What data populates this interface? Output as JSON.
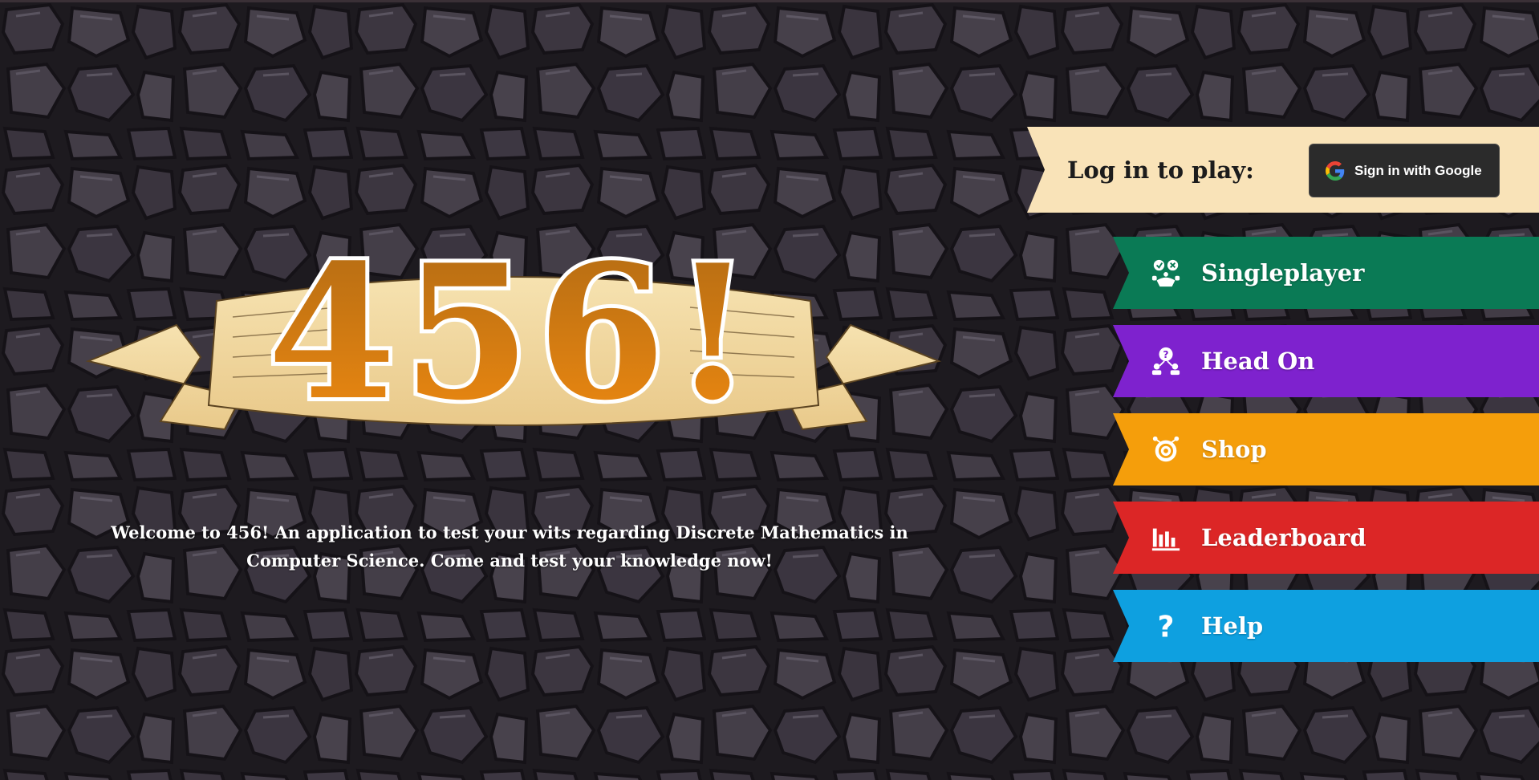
{
  "colors": {
    "singleplayer": "#0a7a55",
    "head_on": "#7e22ce",
    "shop": "#f59e0b",
    "leaderboard": "#dc2626",
    "help": "#0ea0e0",
    "login_banner": "#f9e3b8",
    "logo_orange": "#d97a10"
  },
  "logo": {
    "text": "456!"
  },
  "welcome": {
    "text": "Welcome to 456! An application to test your wits regarding Discrete Mathematics in Computer Science. Come and test your knowledge now!"
  },
  "login": {
    "label": "Log in to play:",
    "google_button": {
      "label": "Sign in with Google",
      "icon": "google-icon"
    }
  },
  "menu": {
    "items": [
      {
        "label": "Singleplayer",
        "icon": "robot-icon"
      },
      {
        "label": "Head On",
        "icon": "versus-icon"
      },
      {
        "label": "Shop",
        "icon": "shop-icon"
      },
      {
        "label": "Leaderboard",
        "icon": "bar-chart-icon"
      },
      {
        "label": "Help",
        "icon": "question-icon"
      }
    ]
  }
}
